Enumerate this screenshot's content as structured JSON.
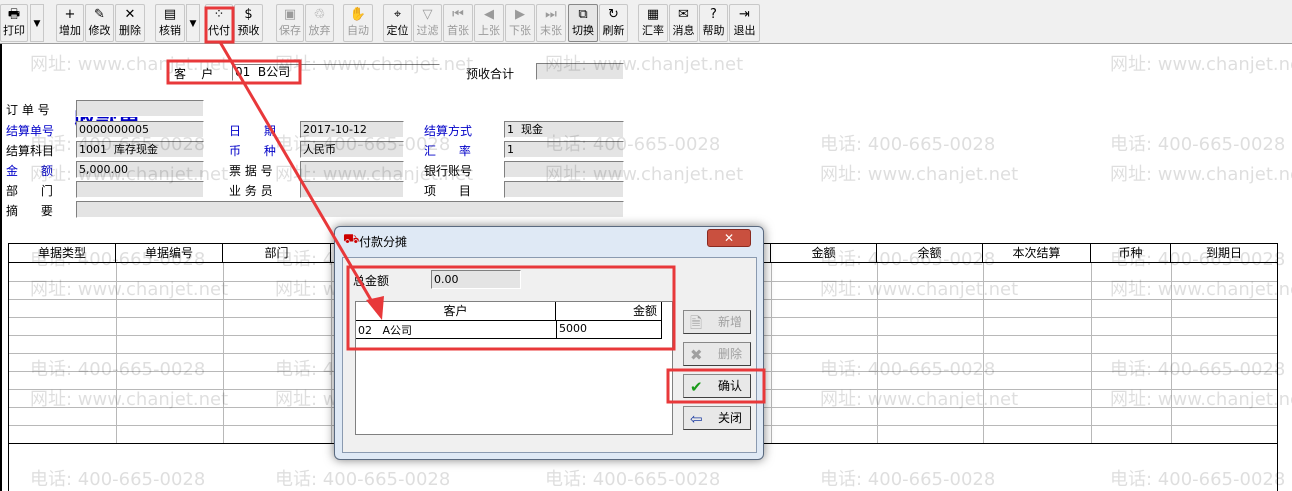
{
  "toolbar": {
    "items": [
      {
        "label": "打印",
        "icon": "printer-icon",
        "glyph": "🖶",
        "enabled": true
      },
      {
        "label": "增加",
        "icon": "add-doc-icon",
        "glyph": "+",
        "enabled": true
      },
      {
        "label": "修改",
        "icon": "edit-icon",
        "glyph": "✎",
        "enabled": true
      },
      {
        "label": "删除",
        "icon": "delete-icon",
        "glyph": "✕",
        "enabled": true
      },
      {
        "label": "核销",
        "icon": "writeoff-icon",
        "glyph": "▤",
        "enabled": true
      },
      {
        "label": "代付",
        "icon": "proxy-pay-icon",
        "glyph": "⁘",
        "enabled": true
      },
      {
        "label": "预收",
        "icon": "prepay-icon",
        "glyph": "$",
        "enabled": true
      },
      {
        "label": "保存",
        "icon": "save-icon",
        "glyph": "▣",
        "enabled": false
      },
      {
        "label": "放弃",
        "icon": "discard-icon",
        "glyph": "♲",
        "enabled": false
      },
      {
        "label": "自动",
        "icon": "auto-icon",
        "glyph": "✋",
        "enabled": false
      },
      {
        "label": "定位",
        "icon": "locate-icon",
        "glyph": "⌖",
        "enabled": true
      },
      {
        "label": "过滤",
        "icon": "filter-icon",
        "glyph": "▽",
        "enabled": false
      },
      {
        "label": "首张",
        "icon": "first-icon",
        "glyph": "⏮",
        "enabled": false
      },
      {
        "label": "上张",
        "icon": "prev-icon",
        "glyph": "◀",
        "enabled": false
      },
      {
        "label": "下张",
        "icon": "next-icon",
        "glyph": "▶",
        "enabled": false
      },
      {
        "label": "末张",
        "icon": "last-icon",
        "glyph": "⏭",
        "enabled": false
      },
      {
        "label": "切换",
        "icon": "switch-icon",
        "glyph": "⧉",
        "enabled": true
      },
      {
        "label": "刷新",
        "icon": "refresh-icon",
        "glyph": "↻",
        "enabled": true
      },
      {
        "label": "汇率",
        "icon": "exchange-rate-icon",
        "glyph": "▦",
        "enabled": true
      },
      {
        "label": "消息",
        "icon": "message-icon",
        "glyph": "✉",
        "enabled": true
      },
      {
        "label": "帮助",
        "icon": "help-icon",
        "glyph": "?",
        "enabled": true
      },
      {
        "label": "退出",
        "icon": "exit-icon",
        "glyph": "⇥",
        "enabled": true
      }
    ]
  },
  "header": {
    "title": "收款单",
    "customer_label": "客    户",
    "customer_value": "01  B公司",
    "prepaid_total_label": "预收合计",
    "prepaid_total_value": ""
  },
  "form": {
    "order_no_label": "订 单 号",
    "order_no": "",
    "settle_no_label": "结算单号",
    "settle_no": "0000000005",
    "date_label": "日      期",
    "date": "2017-10-12",
    "settle_method_label": "结算方式",
    "settle_method": "1  现金",
    "account_label": "结算科目",
    "account": "1001  库存现金",
    "currency_label": "币      种",
    "currency": "人民币",
    "rate_label": "汇      率",
    "rate": "1",
    "amount_label": "金      额",
    "amount": "5,000.00",
    "bill_no_label": "票 据 号",
    "bill_no": "",
    "bank_account_label": "银行账号",
    "bank_account": "",
    "dept_label": "部      门",
    "dept": "",
    "salesman_label": "业 务 员",
    "salesman": "",
    "project_label": "项      目",
    "project": "",
    "memo_label": "摘      要",
    "memo": ""
  },
  "grid": {
    "columns": [
      "单据类型",
      "单据编号",
      "部门",
      "",
      "",
      "",
      "",
      "金额",
      "余额",
      "本次结算",
      "币种",
      "到期日"
    ]
  },
  "dialog": {
    "title": "付款分摊",
    "close": "✕",
    "total_label": "总金额",
    "total_value": "0.00",
    "columns": [
      "客户",
      "金额"
    ],
    "rows": [
      {
        "customer": "02   A公司",
        "amount": "5000"
      }
    ],
    "add": "新增",
    "delete": "删除",
    "confirm": "确认",
    "close_btn": "关闭"
  },
  "watermark": {
    "phone": "电话: 400-665-0028",
    "site": "网址: www.chanjet.net"
  },
  "colors": {
    "accent_blue": "#0000c8",
    "annotation_red": "#e8383a"
  }
}
